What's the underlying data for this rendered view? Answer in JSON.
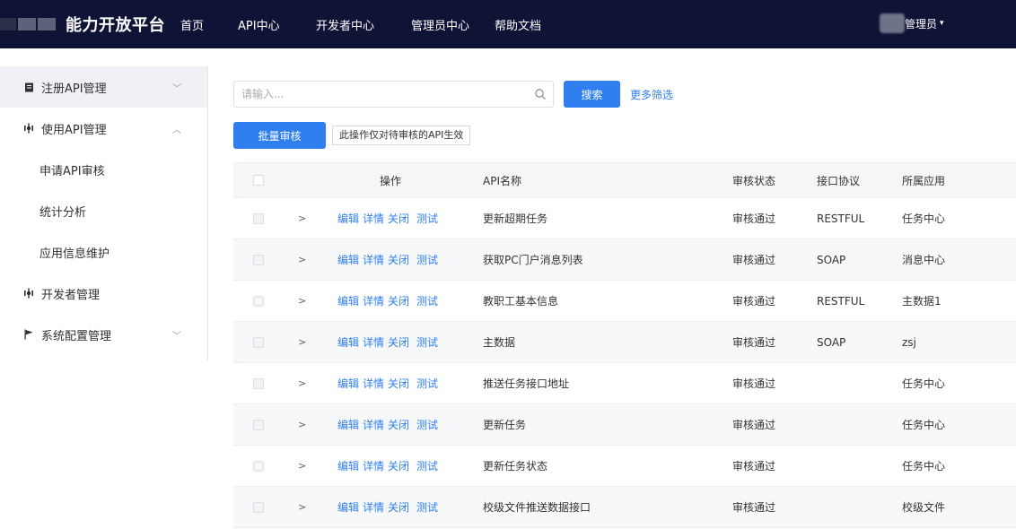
{
  "header": {
    "brand": "能力开放平台",
    "nav": [
      "首页",
      "API中心",
      "开发者中心",
      "管理员中心",
      "帮助文档"
    ],
    "user_label": "管理员",
    "user_caret": "▾"
  },
  "sidebar": {
    "items": [
      {
        "label": "注册API管理",
        "icon": "document-icon",
        "chevron": "﹀"
      },
      {
        "label": "使用API管理",
        "icon": "api-icon",
        "chevron": "︿"
      },
      {
        "label": "申请API审核"
      },
      {
        "label": "统计分析"
      },
      {
        "label": "应用信息维护"
      },
      {
        "label": "开发者管理",
        "icon": "developer-icon"
      },
      {
        "label": "系统配置管理",
        "icon": "flag-icon",
        "chevron": "﹀"
      }
    ]
  },
  "toolbar": {
    "search_placeholder": "请输入...",
    "search_button": "搜索",
    "more_filters": "更多筛选",
    "batch_review": "批量审核",
    "note": "此操作仅对待审核的API生效"
  },
  "table": {
    "columns": [
      "操作",
      "API名称",
      "审核状态",
      "接口协议",
      "所属应用"
    ],
    "ops": [
      "编辑",
      "详情",
      "关闭",
      "测试"
    ],
    "expand_glyph": ">",
    "rows": [
      {
        "name": "更新超期任务",
        "status": "审核通过",
        "protocol": "RESTFUL",
        "app": "任务中心"
      },
      {
        "name": "获取PC门户消息列表",
        "status": "审核通过",
        "protocol": "SOAP",
        "app": "消息中心"
      },
      {
        "name": "教职工基本信息",
        "status": "审核通过",
        "protocol": "RESTFUL",
        "app": "主数据1"
      },
      {
        "name": "主数据",
        "status": "审核通过",
        "protocol": "SOAP",
        "app": "zsj"
      },
      {
        "name": "推送任务接口地址",
        "status": "审核通过",
        "protocol": "",
        "app": "任务中心"
      },
      {
        "name": "更新任务",
        "status": "审核通过",
        "protocol": "",
        "app": "任务中心"
      },
      {
        "name": "更新任务状态",
        "status": "审核通过",
        "protocol": "",
        "app": "任务中心"
      },
      {
        "name": "校级文件推送数据接口",
        "status": "审核通过",
        "protocol": "",
        "app": "校级文件"
      }
    ]
  },
  "colors": {
    "topbar": "#0f1437",
    "primary": "#2f7ff0"
  }
}
